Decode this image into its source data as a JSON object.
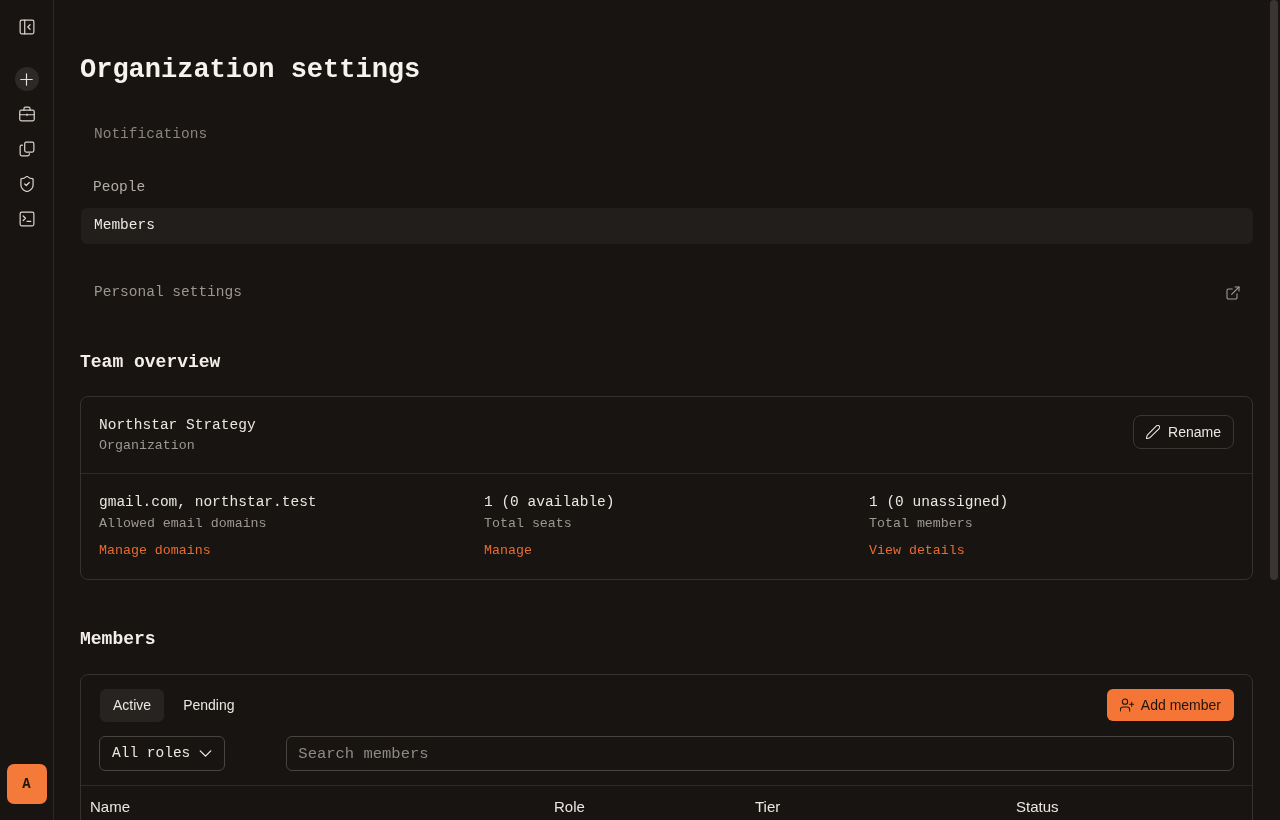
{
  "sidebar": {
    "avatar": "A"
  },
  "page_title": "Organization settings",
  "settings_nav": [
    {
      "kind": "link",
      "label": "Notifications",
      "selected": false
    },
    {
      "kind": "group",
      "label": "People",
      "children": [
        {
          "label": "Members",
          "selected": true
        }
      ]
    },
    {
      "kind": "external",
      "label": "Personal settings",
      "selected": false
    }
  ],
  "team_overview": {
    "heading": "Team overview",
    "org_name": "Northstar Strategy",
    "org_type": "Organization",
    "rename_button": "Rename",
    "stats": [
      {
        "value": "gmail.com, northstar.test",
        "label": "Allowed email domains",
        "action": "Manage domains"
      },
      {
        "value": "1 (0 available)",
        "label": "Total seats",
        "action": "Manage"
      },
      {
        "value": "1 (0 unassigned)",
        "label": "Total members",
        "action": "View details"
      }
    ]
  },
  "members": {
    "heading": "Members",
    "tabs": [
      {
        "label": "Active",
        "selected": true
      },
      {
        "label": "Pending",
        "selected": false
      }
    ],
    "add_button": "Add member",
    "role_filter": "All roles",
    "search": {
      "placeholder": "Search members"
    },
    "table": {
      "columns": [
        "Name",
        "Role",
        "Tier",
        "Status"
      ]
    }
  }
}
